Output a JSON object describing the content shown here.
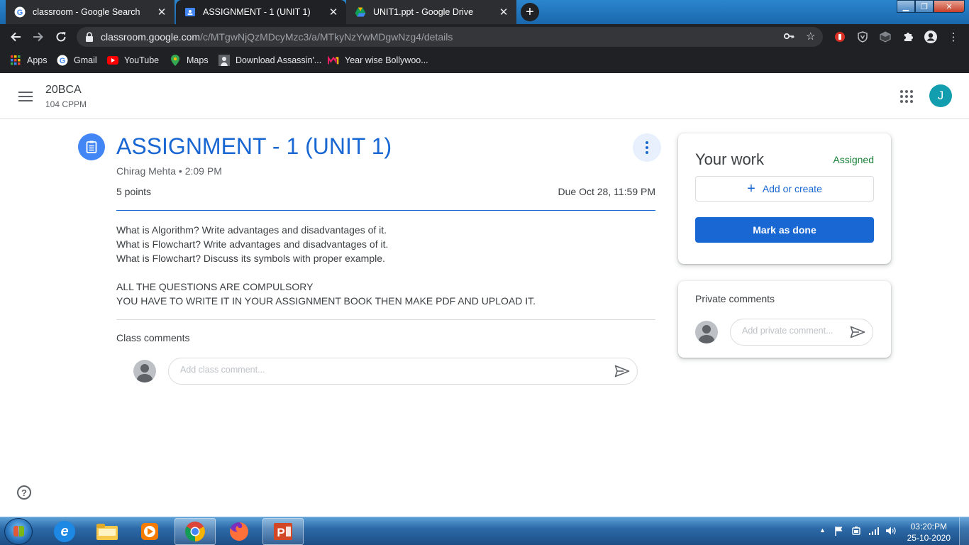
{
  "browser": {
    "tabs": [
      {
        "title": "classroom - Google Search",
        "icon": "google-icon"
      },
      {
        "title": "ASSIGNMENT - 1 (UNIT 1)",
        "icon": "classroom-icon"
      },
      {
        "title": "UNIT1.ppt - Google Drive",
        "icon": "drive-icon"
      }
    ],
    "active_tab_index": 1,
    "url_host": "classroom.google.com",
    "url_path": "/c/MTgwNjQzMDcyMzc3/a/MTkyNzYwMDgwNzg4/details",
    "bookmarks": [
      {
        "label": "Apps",
        "icon": "apps-grid-icon"
      },
      {
        "label": "Gmail",
        "icon": "google-icon"
      },
      {
        "label": "YouTube",
        "icon": "youtube-icon"
      },
      {
        "label": "Maps",
        "icon": "maps-pin-icon"
      },
      {
        "label": "Download Assassin'...",
        "icon": "game-thumb-icon"
      },
      {
        "label": "Year wise Bollywoo...",
        "icon": "m-logo-icon"
      }
    ]
  },
  "classroom": {
    "class_name": "20BCA",
    "section": "104 CPPM",
    "avatar_letter": "J",
    "avatar_color": "#129eaf"
  },
  "assignment": {
    "title": "ASSIGNMENT - 1 (UNIT 1)",
    "meta": "Chirag Mehta • 2:09 PM",
    "points": "5 points",
    "due": "Due Oct 28, 11:59 PM",
    "description": [
      "What is Algorithm? Write advantages and disadvantages of it.",
      "What is Flowchart? Write advantages and disadvantages of it.",
      "What is Flowchart? Discuss its symbols with proper example.",
      "",
      "ALL THE QUESTIONS ARE COMPULSORY",
      "YOU HAVE TO WRITE IT IN YOUR ASSIGNMENT BOOK THEN MAKE PDF AND UPLOAD IT."
    ],
    "class_comments_label": "Class comments",
    "class_comment_placeholder": "Add class comment..."
  },
  "your_work": {
    "title": "Your work",
    "status": "Assigned",
    "status_color": "#188038",
    "add_label": "Add or create",
    "done_label": "Mark as done"
  },
  "private_comments": {
    "title": "Private comments",
    "placeholder": "Add private comment..."
  },
  "taskbar": {
    "apps": [
      "internet-explorer-icon",
      "file-explorer-icon",
      "media-player-icon",
      "chrome-icon",
      "firefox-icon",
      "powerpoint-icon"
    ],
    "time": "03:20:PM",
    "date": "25-10-2020"
  }
}
